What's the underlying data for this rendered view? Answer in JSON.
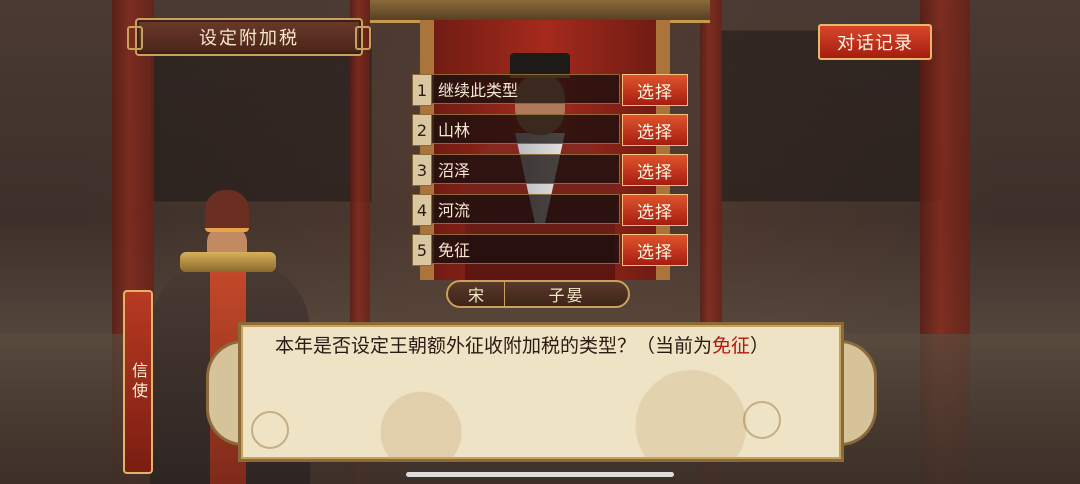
{
  "header": {
    "title": "设定附加税",
    "log_button": "对话记录"
  },
  "options": [
    {
      "num": "1",
      "label": "继续此类型",
      "choose": "选择"
    },
    {
      "num": "2",
      "label": "山林",
      "choose": "选择"
    },
    {
      "num": "3",
      "label": "沼泽",
      "choose": "选择"
    },
    {
      "num": "4",
      "label": "河流",
      "choose": "选择"
    },
    {
      "num": "5",
      "label": "免征",
      "choose": "选择"
    }
  ],
  "speaker": {
    "surname": "宋",
    "given_name": "子晏"
  },
  "messenger": {
    "role": "信使"
  },
  "dialog": {
    "text_before": "本年是否设定王朝额外征收附加税的类型？（当前为",
    "highlight": "免征",
    "text_after": "）"
  },
  "colors": {
    "accent_red": "#b01a10",
    "button_red": "#d8462a",
    "gold_border": "#c9a15a"
  }
}
